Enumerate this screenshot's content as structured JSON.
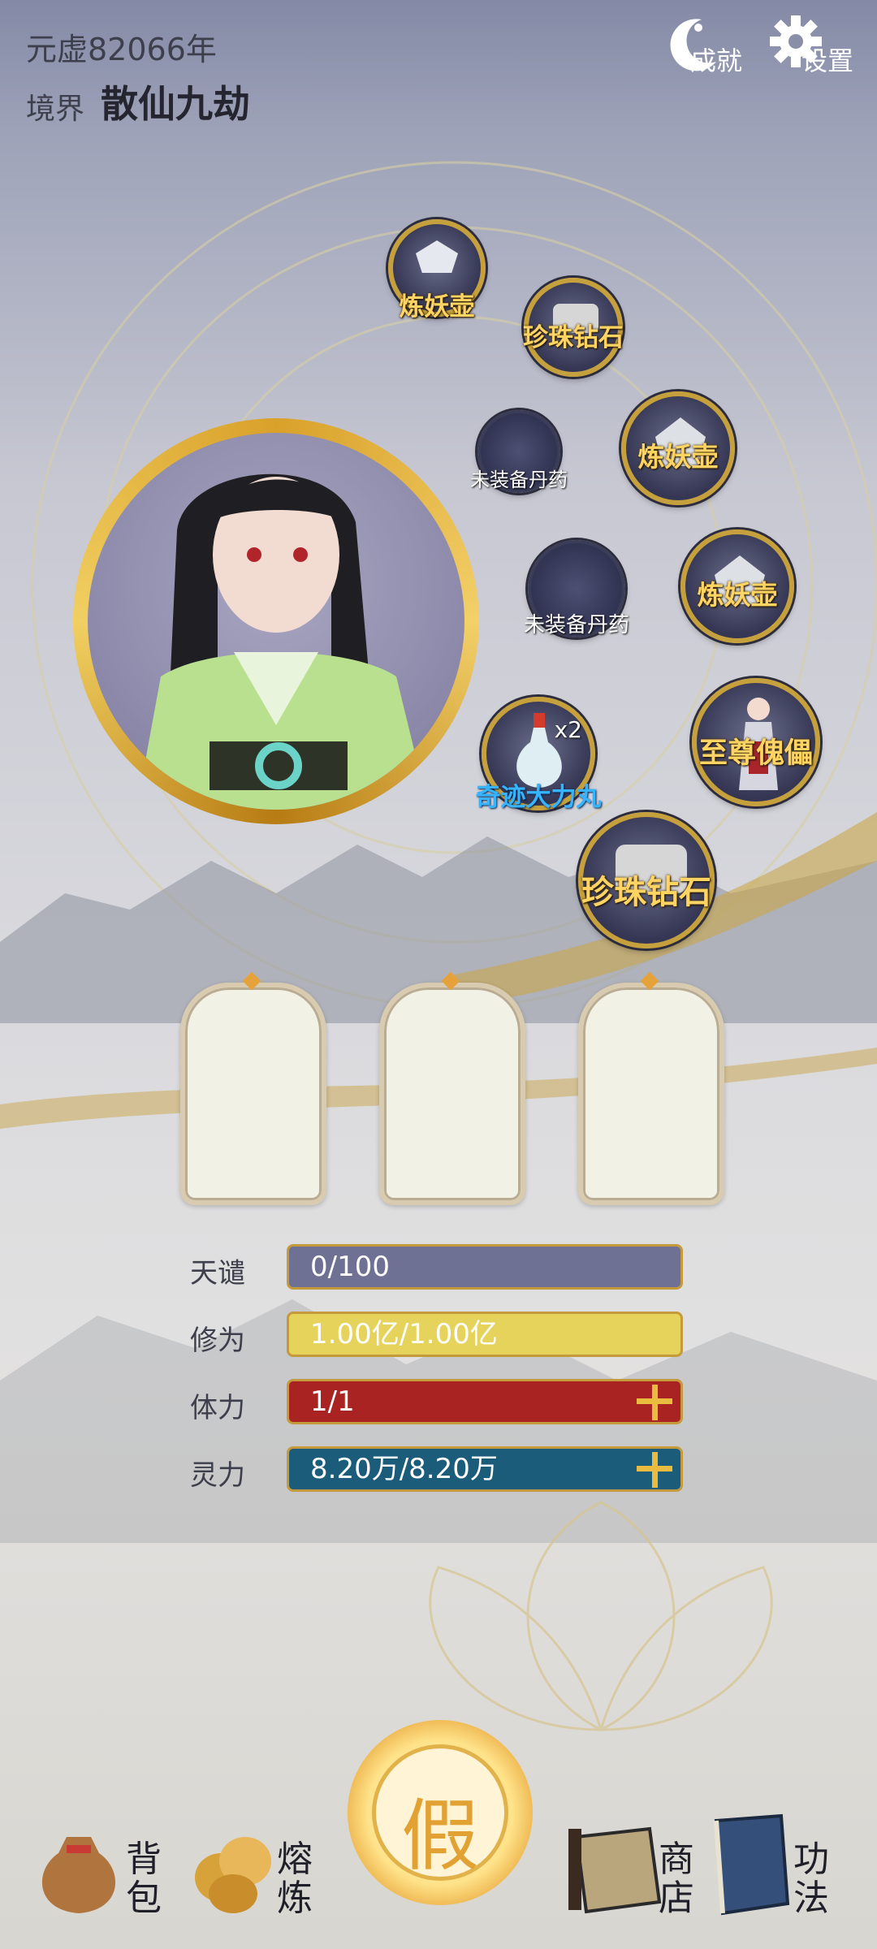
{
  "header": {
    "era": "元虚82066年",
    "realm_label": "境界",
    "realm_value": "散仙九劫",
    "achievements_label": "成就",
    "settings_label": "设置"
  },
  "equipment": [
    {
      "label": "炼妖壶",
      "icon": "pot-icon"
    },
    {
      "label": "珍珠钻石",
      "icon": "diamond-icon"
    },
    {
      "label": "未装备丹药",
      "icon": "empty-slot"
    },
    {
      "label": "炼妖壶",
      "icon": "pot-icon"
    },
    {
      "label": "未装备丹药",
      "icon": "empty-slot"
    },
    {
      "label": "炼妖壶",
      "icon": "pot-icon"
    },
    {
      "label": "x2",
      "icon": "vase-icon"
    },
    {
      "label": "奇迹大力丸",
      "icon": "vase-icon"
    },
    {
      "label": "至尊傀儡",
      "icon": "puppet-icon"
    },
    {
      "label": "珍珠钻石",
      "icon": "diamond-icon"
    }
  ],
  "stats": [
    {
      "label": "天谴",
      "value": "0/100",
      "color": "#6e7194",
      "fill": 0
    },
    {
      "label": "修为",
      "value": "1.00亿/1.00亿",
      "color": "#e6d35c",
      "fill": 1
    },
    {
      "label": "体力",
      "value": "1/1",
      "color": "#a82322",
      "fill": 1
    },
    {
      "label": "灵力",
      "value": "8.20万/8.20万",
      "color": "#1b5c7a",
      "fill": 1
    }
  ],
  "center_button": "假",
  "bottom_nav": [
    {
      "label": "背包"
    },
    {
      "label": "熔炼"
    },
    {
      "label": "商店"
    },
    {
      "label": "功法"
    }
  ]
}
